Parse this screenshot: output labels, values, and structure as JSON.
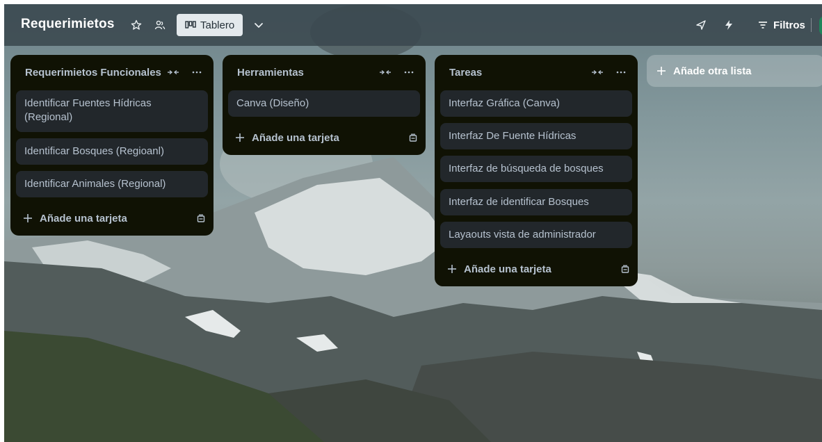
{
  "header": {
    "board_title": "Requerimietos",
    "view_label": "Tablero",
    "filter_label": "Filtros",
    "icons": [
      "star-icon",
      "workspace-visibility-icon",
      "board-view-icon",
      "chevron-down-icon",
      "power-ups-icon",
      "automation-icon",
      "filter-icon"
    ]
  },
  "lists": [
    {
      "title": "Requerimietos Funcionales",
      "cards": [
        "Identificar Fuentes Hídricas (Regional)",
        "Identificar Bosques (Regioanl)",
        "Identificar Animales (Regional)"
      ],
      "add_card_label": "Añade una tarjeta"
    },
    {
      "title": "Herramientas",
      "cards": [
        "Canva (Diseño)"
      ],
      "add_card_label": "Añade una tarjeta"
    },
    {
      "title": "Tareas",
      "cards": [
        "Interfaz Gráfica (Canva)",
        "Interfaz De Fuente Hídricas",
        "Interfaz de búsqueda de bosques",
        "Interfaz de identificar Bosques",
        "Layaouts vista de administrador"
      ],
      "add_card_label": "Añade una tarjeta"
    }
  ],
  "add_list_label": "Añade otra lista",
  "colors": {
    "list_bg": "#101204",
    "card_bg": "#22272b",
    "text": "#b6c2cf",
    "header_bg": "#3a484e",
    "view_button_bg": "#e3e9ec"
  }
}
